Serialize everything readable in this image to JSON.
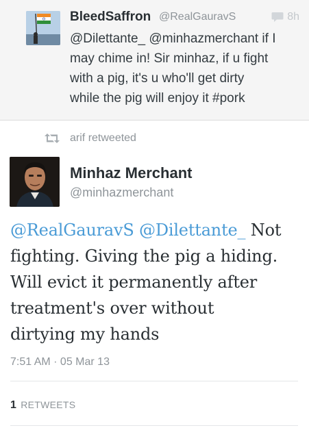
{
  "reply": {
    "name": "BleedSaffron",
    "handle": "@RealGauravS",
    "time": "8h",
    "text_lines": [
      "@Dilettante_ @minhazmerchant if I",
      "may chime in! Sir minhaz, if u fight",
      "with a pig, it's u who'll get dirty",
      "while the pig will enjoy it #pork"
    ],
    "avatar_icon": "flag-avatar",
    "reply_icon": "speech-bubble-icon"
  },
  "retweet_banner": {
    "user": "arif",
    "label": "retweeted",
    "icon": "retweet-icon"
  },
  "tweet": {
    "name": "Minhaz Merchant",
    "handle": "@minhazmerchant",
    "mention1": "@RealGauravS",
    "mention2": "@Dilettante_",
    "body_line1": "Not",
    "body_lines": [
      "fighting. Giving the pig a hiding.",
      "Will evict it permanently after",
      "treatment's over without",
      "dirtying my hands"
    ],
    "timestamp": "7:51 AM · 05 Mar 13",
    "retweet_count": "1",
    "retweet_label": "RETWEETS"
  },
  "colors": {
    "mention": "#4a9bd6",
    "muted": "#8e9499",
    "reply_bg": "#f5f5f5"
  }
}
